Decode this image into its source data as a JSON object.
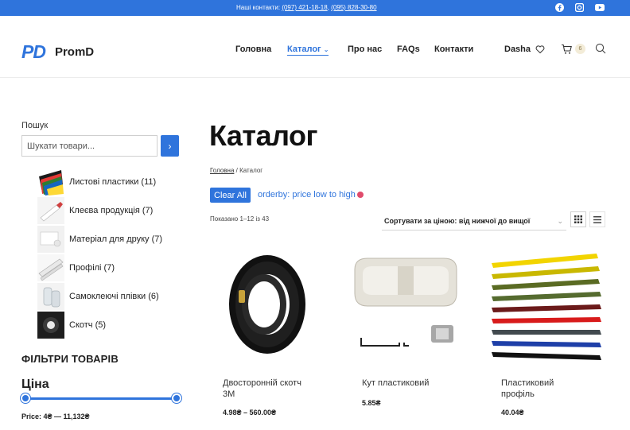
{
  "topbar": {
    "contacts_label": "Наші контакти:",
    "phone_1": "(097) 421-18-18",
    "sep": ",",
    "phone_2": "(095) 828-30-80",
    "social_icons": [
      "facebook-icon",
      "instagram-icon",
      "youtube-icon"
    ]
  },
  "brand": {
    "mark": "PD",
    "name": "PromD",
    "color": "#2f74dc"
  },
  "nav": {
    "items": [
      "Головна",
      "Каталог",
      "Про нас",
      "FAQs",
      "Контакти",
      "Dasha"
    ],
    "active": "Каталог",
    "cart_count": "6"
  },
  "sidebar": {
    "search_label": "Пошук",
    "search_placeholder": "Шукати товари...",
    "search_button": "›",
    "categories": [
      {
        "label": "Листові пластики (11)"
      },
      {
        "label": "Клеєва продукція (7)"
      },
      {
        "label": "Матеріал для друку (7)"
      },
      {
        "label": "Профілі (7)"
      },
      {
        "label": "Самоклеючі плівки (6)"
      },
      {
        "label": "Скотч (5)"
      }
    ],
    "filters_title": "ФІЛЬТРИ ТОВАРІВ",
    "price_title": "Ціна",
    "price_range": "Price: 4₴ — 11,132₴"
  },
  "main": {
    "title": "Каталог",
    "breadcrumb_home": "Головна",
    "breadcrumb_sep": "/",
    "breadcrumb_current": "Каталог",
    "clear_all": "Clear All",
    "orderby_tag": "orderby: price low to high",
    "result_count": "Показано 1–12 із 43",
    "sort_value": "Сортувати за ціною: від нижчої до вищої",
    "products": [
      {
        "title": "Двосторонній скотч 3М",
        "price": "4.98₴ – 560.00₴"
      },
      {
        "title": "Кут пластиковий",
        "price": "5.85₴"
      },
      {
        "title": "Пластиковий профіль",
        "price": "40.04₴"
      }
    ]
  },
  "colors": {
    "accent": "#2f74dc",
    "tag_remove": "#e04c6c"
  }
}
